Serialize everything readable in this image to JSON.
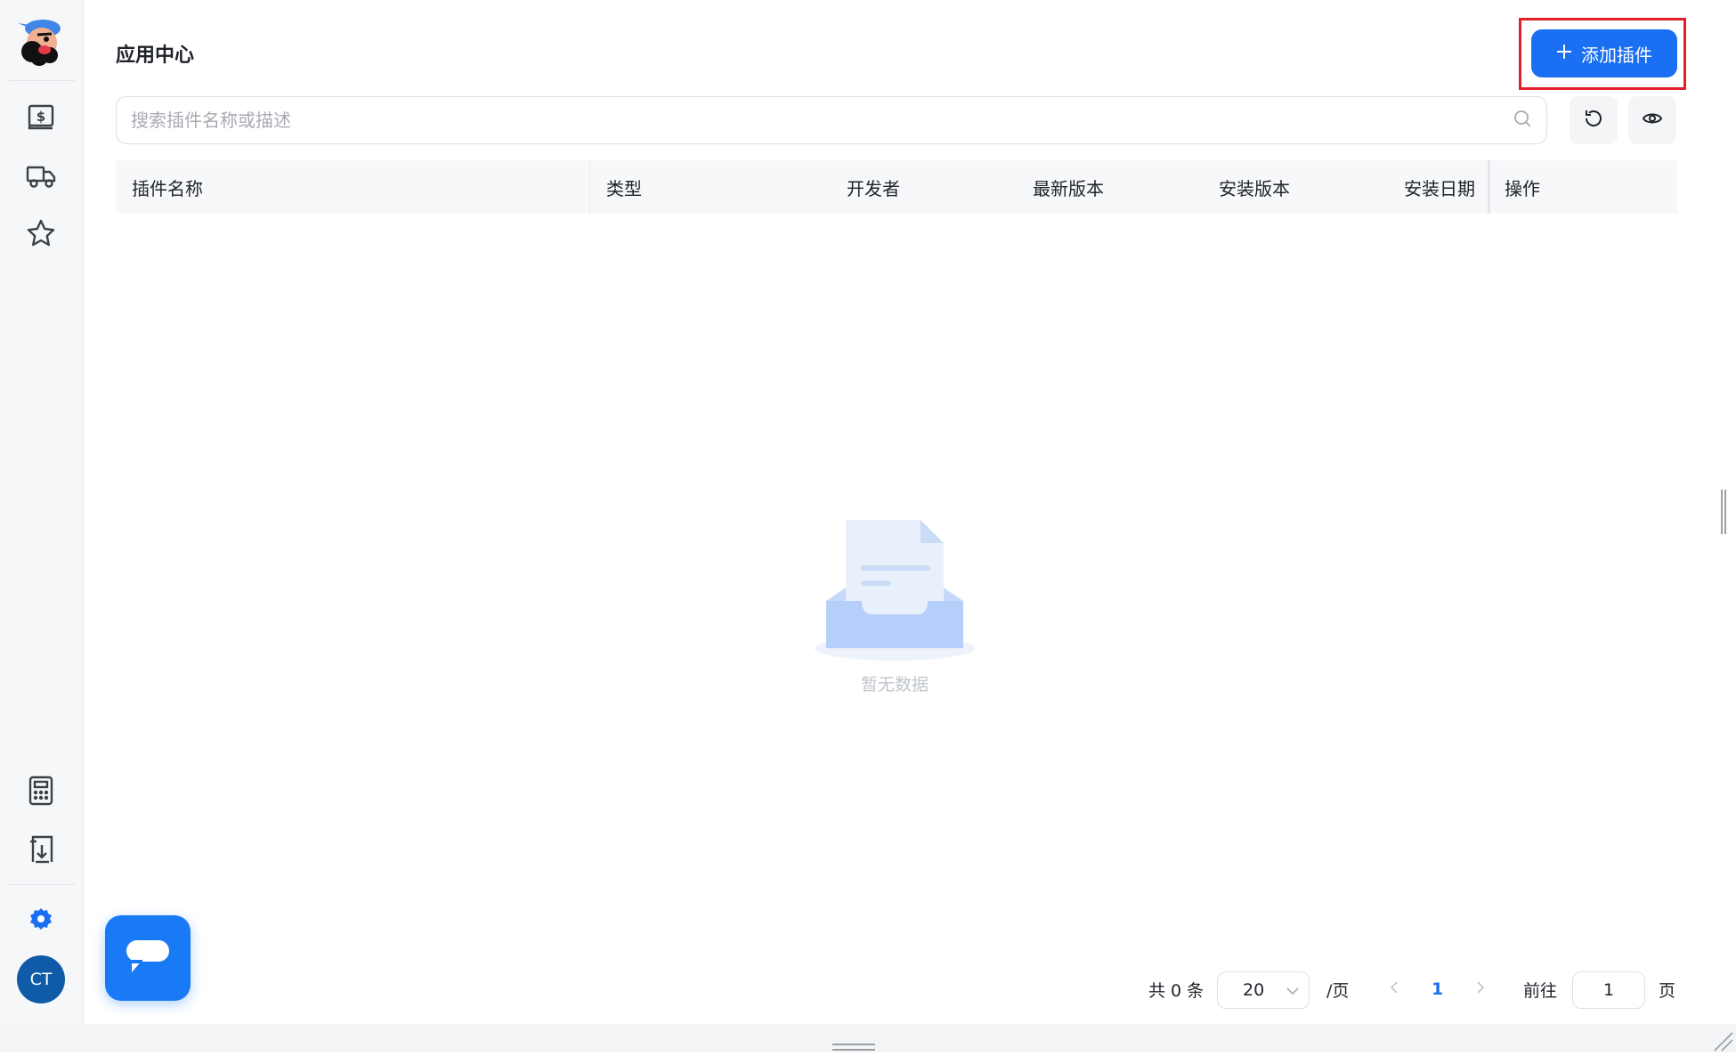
{
  "sidebar": {
    "icons": [
      "mascot-logo",
      "dollar-ledger-icon",
      "truck-icon",
      "star-icon",
      "calculator-icon",
      "download-doc-icon",
      "gear-icon"
    ],
    "avatar_initials": "CT",
    "accent": "#1a6ff2"
  },
  "header": {
    "title": "应用中心",
    "add_button_label": "添加插件",
    "highlight_color": "#e0202a"
  },
  "search": {
    "placeholder": "搜索插件名称或描述"
  },
  "table": {
    "columns": [
      "插件名称",
      "类型",
      "开发者",
      "最新版本",
      "安装版本",
      "安装日期",
      "操作"
    ],
    "rows": [],
    "empty_text": "暂无数据"
  },
  "pagination": {
    "total_label": "共 0 条",
    "page_size": "20",
    "per_page_label": "/页",
    "current_page": "1",
    "goto_label": "前往",
    "goto_value": "1",
    "page_suffix": "页"
  }
}
